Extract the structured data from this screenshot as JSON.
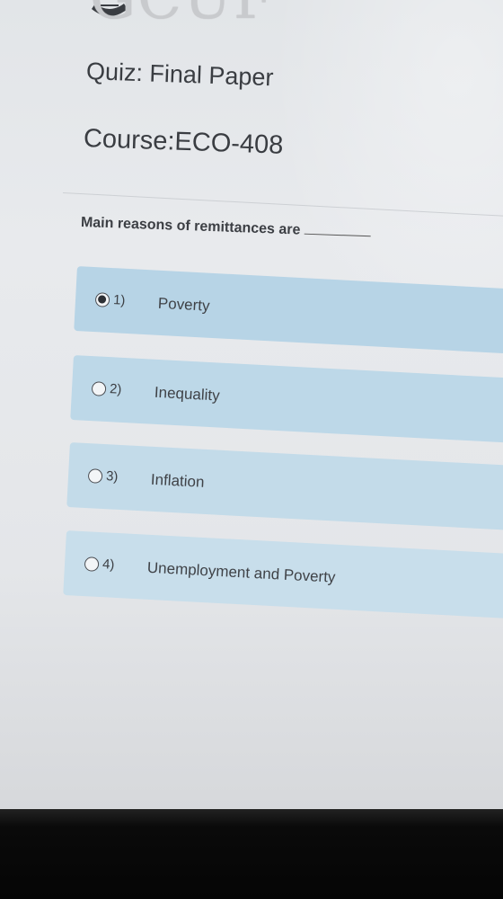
{
  "header": {
    "logo_text": "GCUF"
  },
  "quiz": {
    "title": "Quiz: Final Paper",
    "course": "Course:ECO-408",
    "question": "Main reasons of remittances are",
    "selected_index": 0,
    "options": [
      {
        "number": "1)",
        "label": "Poverty"
      },
      {
        "number": "2)",
        "label": "Inequality"
      },
      {
        "number": "3)",
        "label": "Inflation"
      },
      {
        "number": "4)",
        "label": "Unemployment and Poverty"
      }
    ]
  },
  "colors": {
    "option_bg": "#bcd7e7",
    "text": "#3a3d42"
  }
}
